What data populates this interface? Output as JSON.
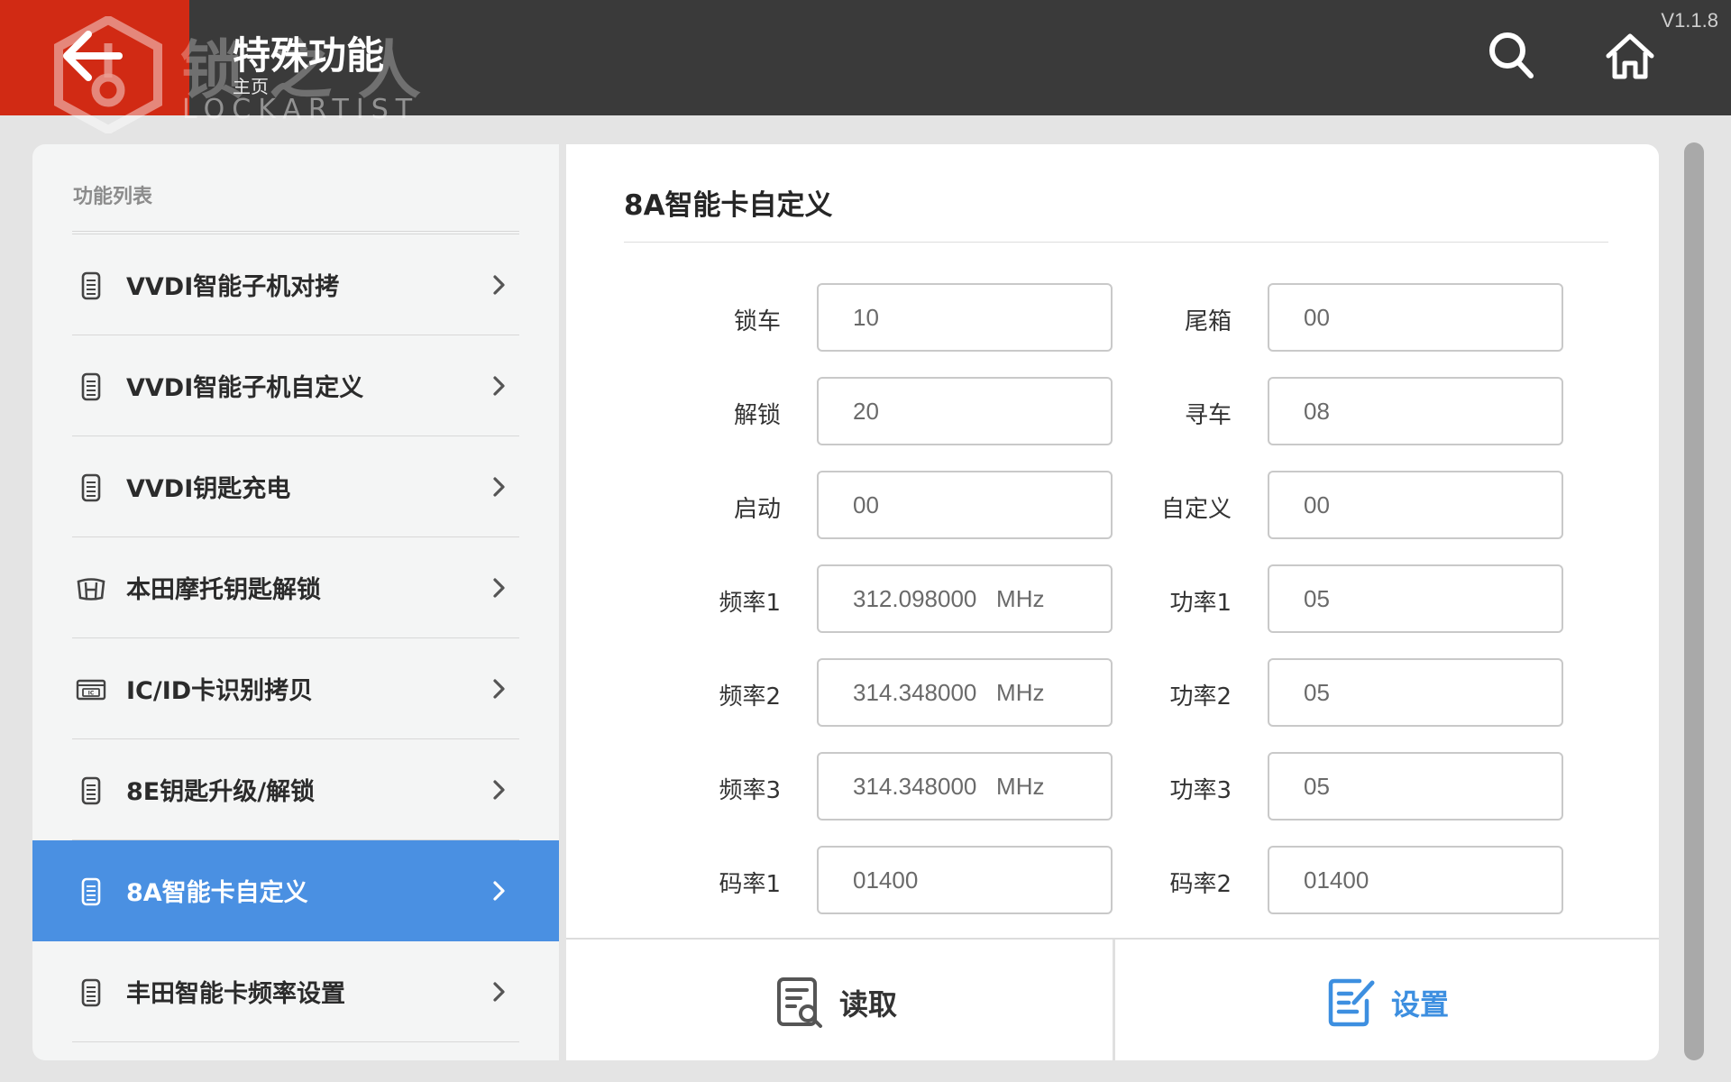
{
  "header": {
    "title": "特殊功能",
    "breadcrumb": "主页",
    "version": "V1.1.8",
    "watermark_cn": "锁 之 人",
    "watermark_en": "LOCKARTIST",
    "back_icon": "arrow-left-icon",
    "search_icon": "search-icon",
    "home_icon": "home-icon",
    "back_bg_color": "#d12a14",
    "bar_color": "#3a3a3a"
  },
  "sidebar": {
    "header": "功能列表",
    "active_color": "#4a90e2",
    "items": [
      {
        "label": "VVDI智能子机对拷",
        "icon": "key-fob-icon"
      },
      {
        "label": "VVDI智能子机自定义",
        "icon": "key-fob-icon"
      },
      {
        "label": "VVDI钥匙充电",
        "icon": "key-fob-icon"
      },
      {
        "label": "本田摩托钥匙解锁",
        "icon": "honda-logo-icon"
      },
      {
        "label": "IC/ID卡识别拷贝",
        "icon": "ic-card-icon"
      },
      {
        "label": "8E钥匙升级/解锁",
        "icon": "key-fob-icon"
      },
      {
        "label": "8A智能卡自定义",
        "icon": "key-fob-icon",
        "active": true
      },
      {
        "label": "丰田智能卡频率设置",
        "icon": "key-fob-icon"
      }
    ]
  },
  "main": {
    "title": "8A智能卡自定义",
    "fields": [
      {
        "label": "锁车",
        "value": "10"
      },
      {
        "label": "尾箱",
        "value": "00"
      },
      {
        "label": "解锁",
        "value": "20"
      },
      {
        "label": "寻车",
        "value": "08"
      },
      {
        "label": "启动",
        "value": "00"
      },
      {
        "label": "自定义",
        "value": "00"
      },
      {
        "label": "频率1",
        "value": "312.098000   MHz"
      },
      {
        "label": "功率1",
        "value": "05"
      },
      {
        "label": "频率2",
        "value": "314.348000   MHz"
      },
      {
        "label": "功率2",
        "value": "05"
      },
      {
        "label": "频率3",
        "value": "314.348000   MHz"
      },
      {
        "label": "功率3",
        "value": "05"
      },
      {
        "label": "码率1",
        "value": "01400"
      },
      {
        "label": "码率2",
        "value": "01400"
      }
    ],
    "read_label": "读取",
    "read_icon": "document-search-icon",
    "set_label": "设置",
    "set_icon": "edit-document-icon",
    "set_color": "#3d8fe0"
  }
}
